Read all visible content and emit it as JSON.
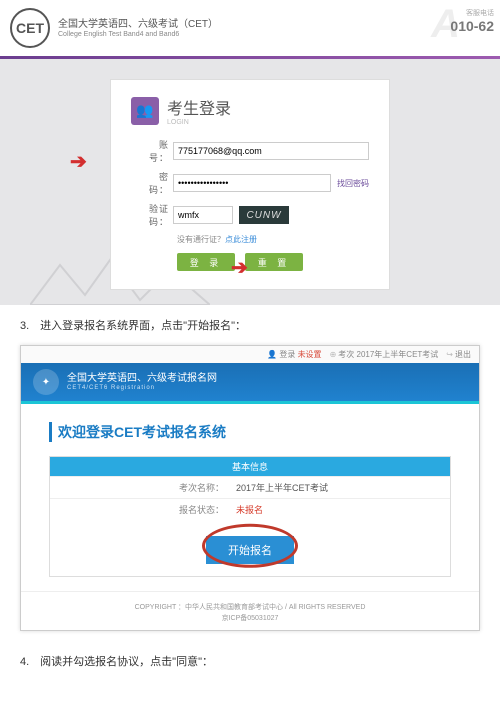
{
  "header": {
    "logo": "CET",
    "title_cn": "全国大学英语四、六级考试（CET）",
    "title_en": "College English Test Band4 and Band6",
    "hotline_label": "客服电话",
    "hotline": "010-62"
  },
  "login": {
    "title": "考生登录",
    "subtitle": "LOGIN",
    "account_label": "账　号：",
    "password_label": "密　码：",
    "captcha_label": "验证码：",
    "account_value": "775177068@qq.com",
    "password_value": "••••••••••••••••",
    "captcha_value": "wmfx",
    "captcha_img": "CUNW",
    "forgot": "找回密码",
    "no_pass_prefix": "没有通行证？",
    "register": "点此注册",
    "btn_login": "登 录",
    "btn_reset": "重 置"
  },
  "step3": "3.　进入登录报名系统界面，点击\"开始报名\"：",
  "reg": {
    "top_login": "登录",
    "top_unset": "未设置",
    "top_exam_label": "考次",
    "top_exam": "2017年上半年CET考试",
    "top_logout": "退出",
    "banner_cn": "全国大学英语四、六级考试报名网",
    "banner_en": "CET4/CET6   Registration",
    "welcome": "欢迎登录CET考试报名系统",
    "info_head": "基本信息",
    "row1_k": "考次名称：",
    "row1_v": "2017年上半年CET考试",
    "row2_k": "报名状态：",
    "row2_v": "未报名",
    "start": "开始报名",
    "copyright": "COPYRIGHT ：中华人民共和国教育部考试中心 / All RIGHTS RESERVED",
    "icp": "京ICP备05031027"
  },
  "step4": "4.　阅读并勾选报名协议，点击\"同意\"："
}
